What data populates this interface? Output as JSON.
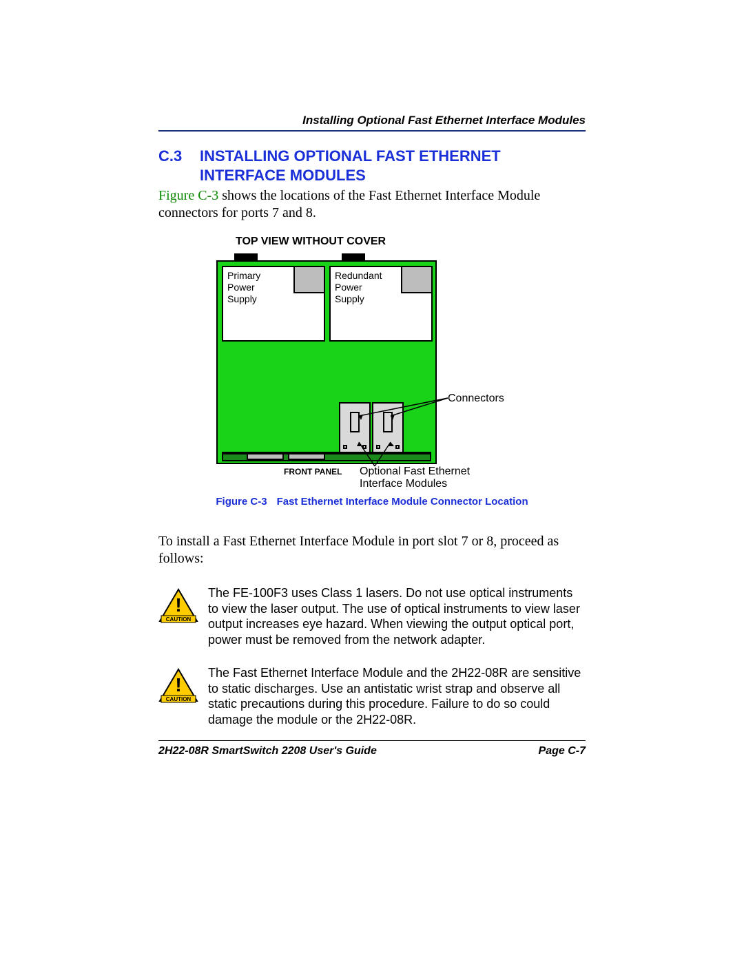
{
  "running_header": "Installing Optional Fast Ethernet Interface Modules",
  "section": {
    "number": "C.3",
    "title_l1": "INSTALLING OPTIONAL FAST ETHERNET",
    "title_l2": "INTERFACE MODULES"
  },
  "intro": {
    "figref": "Figure C-3",
    "rest": " shows the locations of the Fast Ethernet Interface Module connectors for ports 7 and 8."
  },
  "diagram": {
    "view_title": "TOP VIEW WITHOUT COVER",
    "primary_ps_l1": "Primary",
    "primary_ps_l2": "Power",
    "primary_ps_l3": "Supply",
    "redundant_ps_l1": "Redundant",
    "redundant_ps_l2": "Power",
    "redundant_ps_l3": "Supply",
    "connectors_label": "Connectors",
    "front_panel_label": "FRONT PANEL",
    "modules_label_l1": "Optional Fast Ethernet",
    "modules_label_l2": "Interface Modules",
    "caption_num": "Figure C-3",
    "caption_text": "Fast Ethernet Interface Module Connector Location"
  },
  "para2": "To install a Fast Ethernet Interface Module in port slot 7 or 8, proceed as follows:",
  "cautions": [
    "The FE-100F3 uses Class 1 lasers. Do not use optical instruments to view the laser output. The use of optical instruments to view laser output increases eye hazard. When viewing the output optical port, power must be removed from the network adapter.",
    "The Fast Ethernet Interface Module and the 2H22-08R are sensitive to static discharges. Use an antistatic wrist strap and observe all static precautions during this procedure. Failure to do so could damage the module or the 2H22-08R."
  ],
  "footer": {
    "left": "2H22-08R SmartSwitch 2208 User's Guide",
    "right": "Page C-7"
  },
  "caution_word": "CAUTION"
}
